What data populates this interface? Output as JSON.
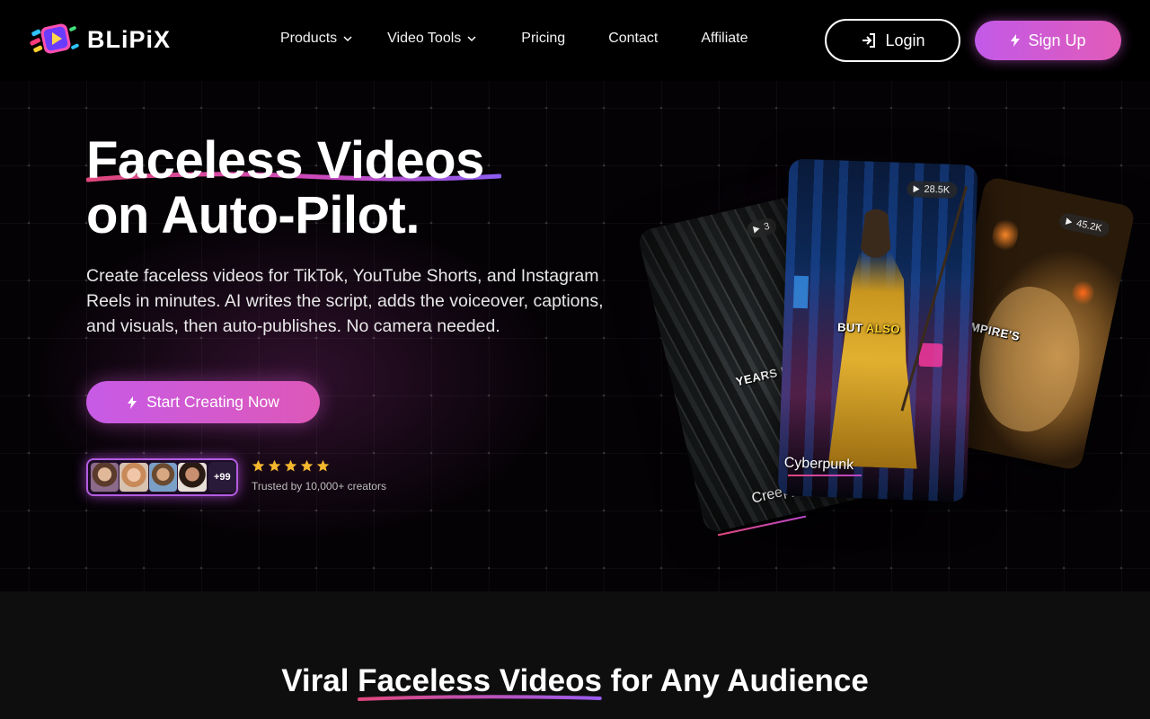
{
  "brand": {
    "name": "BLiPiX"
  },
  "nav": {
    "items": [
      {
        "label": "Products",
        "dropdown": true
      },
      {
        "label": "Video Tools",
        "dropdown": true
      },
      {
        "label": "Pricing",
        "dropdown": false
      },
      {
        "label": "Contact",
        "dropdown": false
      },
      {
        "label": "Affiliate",
        "dropdown": false
      }
    ],
    "login_label": "Login",
    "signup_label": "Sign Up"
  },
  "hero": {
    "title_line1": "Faceless Videos",
    "title_line2": "on Auto-Pilot.",
    "description": "Create faceless videos for TikTok, YouTube Shorts, and Instagram Reels in minutes. AI writes the script, adds the voiceover, captions, and visuals, then auto-publishes. No camera needed.",
    "cta_label": "Start Creating Now",
    "avatars_more": "+99",
    "rating_stars": 5,
    "trusted_text": "Trusted by 10,000+ creators",
    "cards": [
      {
        "style": "Creepy Comic",
        "caption": "YEARS LA",
        "views": "3"
      },
      {
        "style": "Cyberpunk",
        "caption_white": "BUT",
        "caption_yellow": "ALSO",
        "views": "28.5K"
      },
      {
        "style": "",
        "caption": "EMPIRE'S",
        "views": "45.2K"
      }
    ]
  },
  "section2": {
    "title_pre": "Viral ",
    "title_highlight": "Faceless Videos",
    "title_post": " for Any Audience",
    "subtitle": ""
  },
  "colors": {
    "accent_gradient_start": "#c25ae8",
    "accent_gradient_end": "#e15bb8",
    "star": "#f5b82e",
    "background": "#000000"
  }
}
